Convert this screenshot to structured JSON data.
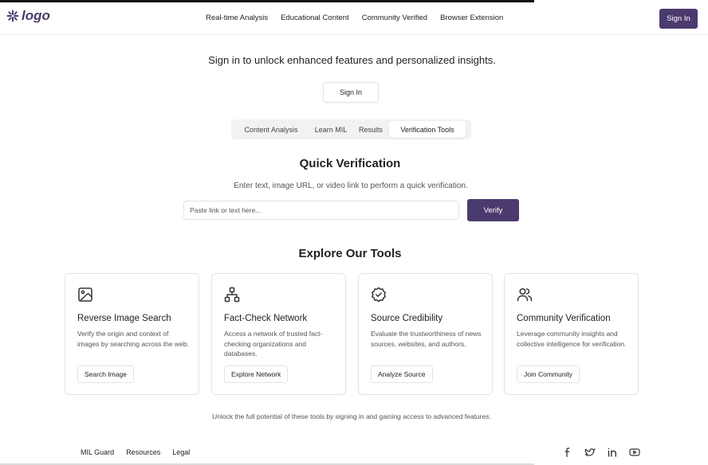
{
  "brand": {
    "logo_text": "logo",
    "accent_color": "#4b3a6e"
  },
  "nav": {
    "links": [
      "Real-time Analysis",
      "Educational Content",
      "Community Verified",
      "Browser Extension"
    ],
    "signin_label": "Sign In"
  },
  "hero": {
    "text": "Sign in to unlock enhanced features and personalized insights.",
    "signin_label": "Sign In"
  },
  "tabs": {
    "items": [
      "Content Analysis",
      "Learn MIL",
      "Results",
      "Verification Tools"
    ],
    "active": "Verification Tools"
  },
  "quick_verification": {
    "title": "Quick Verification",
    "subtitle": "Enter text, image URL, or video link to perform a quick verification.",
    "input_placeholder": "Paste link or text here...",
    "input_value": "",
    "button_label": "Verify"
  },
  "tools": {
    "title": "Explore Our Tools",
    "cards": [
      {
        "icon": "image-icon",
        "title": "Reverse Image Search",
        "description": "Verify the origin and context of images by searching across the web.",
        "button": "Search Image"
      },
      {
        "icon": "network-icon",
        "title": "Fact-Check Network",
        "description": "Access a network of trusted fact-checking organizations and databases.",
        "button": "Explore Network"
      },
      {
        "icon": "badge-check-icon",
        "title": "Source Credibility",
        "description": "Evaluate the trustworthiness of news sources, websites, and authors.",
        "button": "Analyze Source"
      },
      {
        "icon": "users-icon",
        "title": "Community Verification",
        "description": "Leverage community insights and collective intelligence for verification.",
        "button": "Join Community"
      }
    ],
    "promo_text": "Unlock the full potential of these tools by signing in and gaining access to advanced features."
  },
  "footer": {
    "links": [
      "MIL Guard",
      "Resources",
      "Legal"
    ],
    "socials": [
      "facebook-icon",
      "twitter-icon",
      "linkedin-icon",
      "youtube-icon"
    ]
  }
}
